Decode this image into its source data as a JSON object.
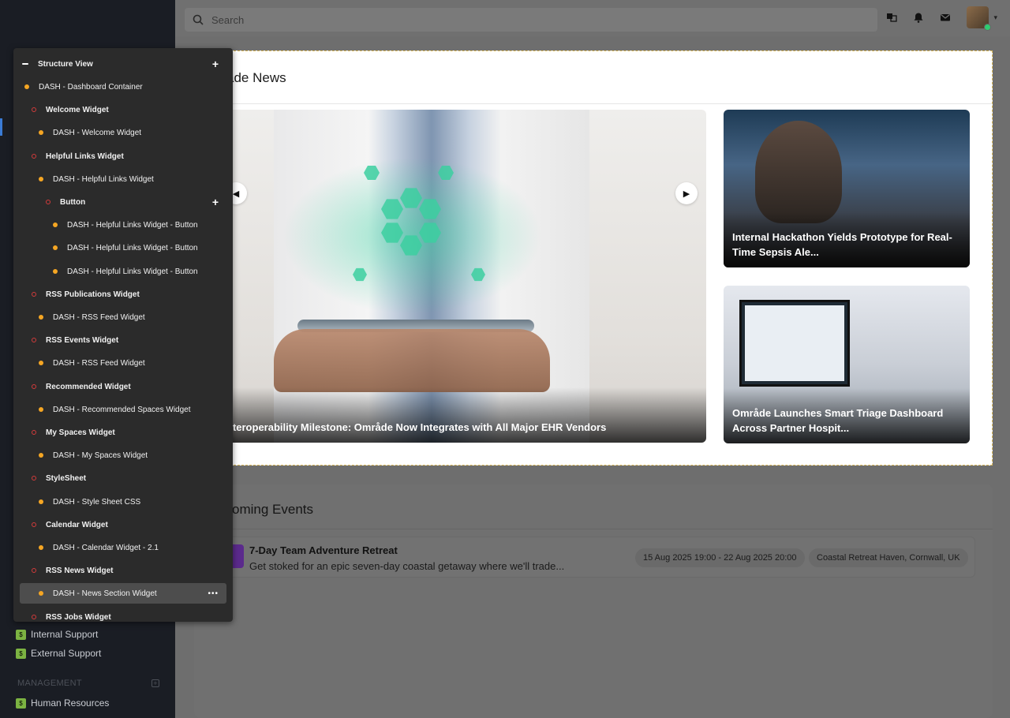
{
  "topbar": {
    "search_placeholder": "Search",
    "icons": [
      "search-icon",
      "translate-icon",
      "bell-icon",
      "mail-icon"
    ]
  },
  "sidebar": {
    "items": [
      {
        "label": "Internal Support",
        "icon_color": "#7cb342"
      },
      {
        "label": "External Support",
        "icon_color": "#7cb342"
      },
      {
        "label": "Human Resources",
        "icon_color": "#7cb342"
      }
    ],
    "section_label": "MANAGEMENT"
  },
  "structure_view": {
    "header": "Structure View",
    "rows": [
      {
        "label": "DASH - Dashboard Container",
        "marker": "orange",
        "bold": false,
        "indent": 0
      },
      {
        "label": "Welcome Widget",
        "marker": "red",
        "bold": true,
        "indent": 1
      },
      {
        "label": "DASH - Welcome Widget",
        "marker": "orange",
        "bold": false,
        "indent": 2
      },
      {
        "label": "Helpful Links Widget",
        "marker": "red",
        "bold": true,
        "indent": 1
      },
      {
        "label": "DASH - Helpful Links Widget",
        "marker": "orange",
        "bold": false,
        "indent": 2
      },
      {
        "label": "Button",
        "marker": "red",
        "bold": true,
        "indent": 3,
        "plus": true
      },
      {
        "label": "DASH - Helpful Links Widget - Button",
        "marker": "orange",
        "bold": false,
        "indent": 4
      },
      {
        "label": "DASH - Helpful Links Widget - Button",
        "marker": "orange",
        "bold": false,
        "indent": 4
      },
      {
        "label": "DASH - Helpful Links Widget - Button",
        "marker": "orange",
        "bold": false,
        "indent": 4
      },
      {
        "label": "RSS Publications Widget",
        "marker": "red",
        "bold": true,
        "indent": 1
      },
      {
        "label": "DASH - RSS Feed Widget",
        "marker": "orange",
        "bold": false,
        "indent": 2
      },
      {
        "label": "RSS Events Widget",
        "marker": "red",
        "bold": true,
        "indent": 1
      },
      {
        "label": "DASH - RSS Feed Widget",
        "marker": "orange",
        "bold": false,
        "indent": 2
      },
      {
        "label": "Recommended Widget",
        "marker": "red",
        "bold": true,
        "indent": 1
      },
      {
        "label": "DASH - Recommended Spaces Widget",
        "marker": "orange",
        "bold": false,
        "indent": 2
      },
      {
        "label": "My Spaces Widget",
        "marker": "red",
        "bold": true,
        "indent": 1
      },
      {
        "label": "DASH - My Spaces Widget",
        "marker": "orange",
        "bold": false,
        "indent": 2
      },
      {
        "label": "StyleSheet",
        "marker": "red",
        "bold": true,
        "indent": 1
      },
      {
        "label": "DASH - Style Sheet CSS",
        "marker": "orange",
        "bold": false,
        "indent": 2
      },
      {
        "label": "Calendar Widget",
        "marker": "red",
        "bold": true,
        "indent": 1
      },
      {
        "label": "DASH - Calendar Widget - 2.1",
        "marker": "orange",
        "bold": false,
        "indent": 2
      },
      {
        "label": "RSS News Widget",
        "marker": "red",
        "bold": true,
        "indent": 1
      },
      {
        "label": "DASH - News Section Widget",
        "marker": "orange",
        "bold": false,
        "indent": 2,
        "selected": true
      },
      {
        "label": "RSS Jobs Widget",
        "marker": "red",
        "bold": true,
        "indent": 1
      }
    ]
  },
  "news": {
    "title": "åde News",
    "hero_caption": "nteroperability Milestone: Område Now Integrates with All Major EHR Vendors",
    "cards": [
      {
        "caption": "Internal Hackathon Yields Prototype for Real-Time Sepsis Ale..."
      },
      {
        "caption": "Område Launches Smart Triage Dashboard Across Partner Hospit..."
      }
    ]
  },
  "events": {
    "title": "oming Events",
    "items": [
      {
        "title": "7-Day Team Adventure Retreat",
        "description": "Get stoked for an epic seven-day coastal getaway where we'll trade...",
        "date": "15 Aug 2025 19:00 - 22 Aug 2025 20:00",
        "location": "Coastal Retreat Haven, Cornwall, UK"
      }
    ]
  }
}
